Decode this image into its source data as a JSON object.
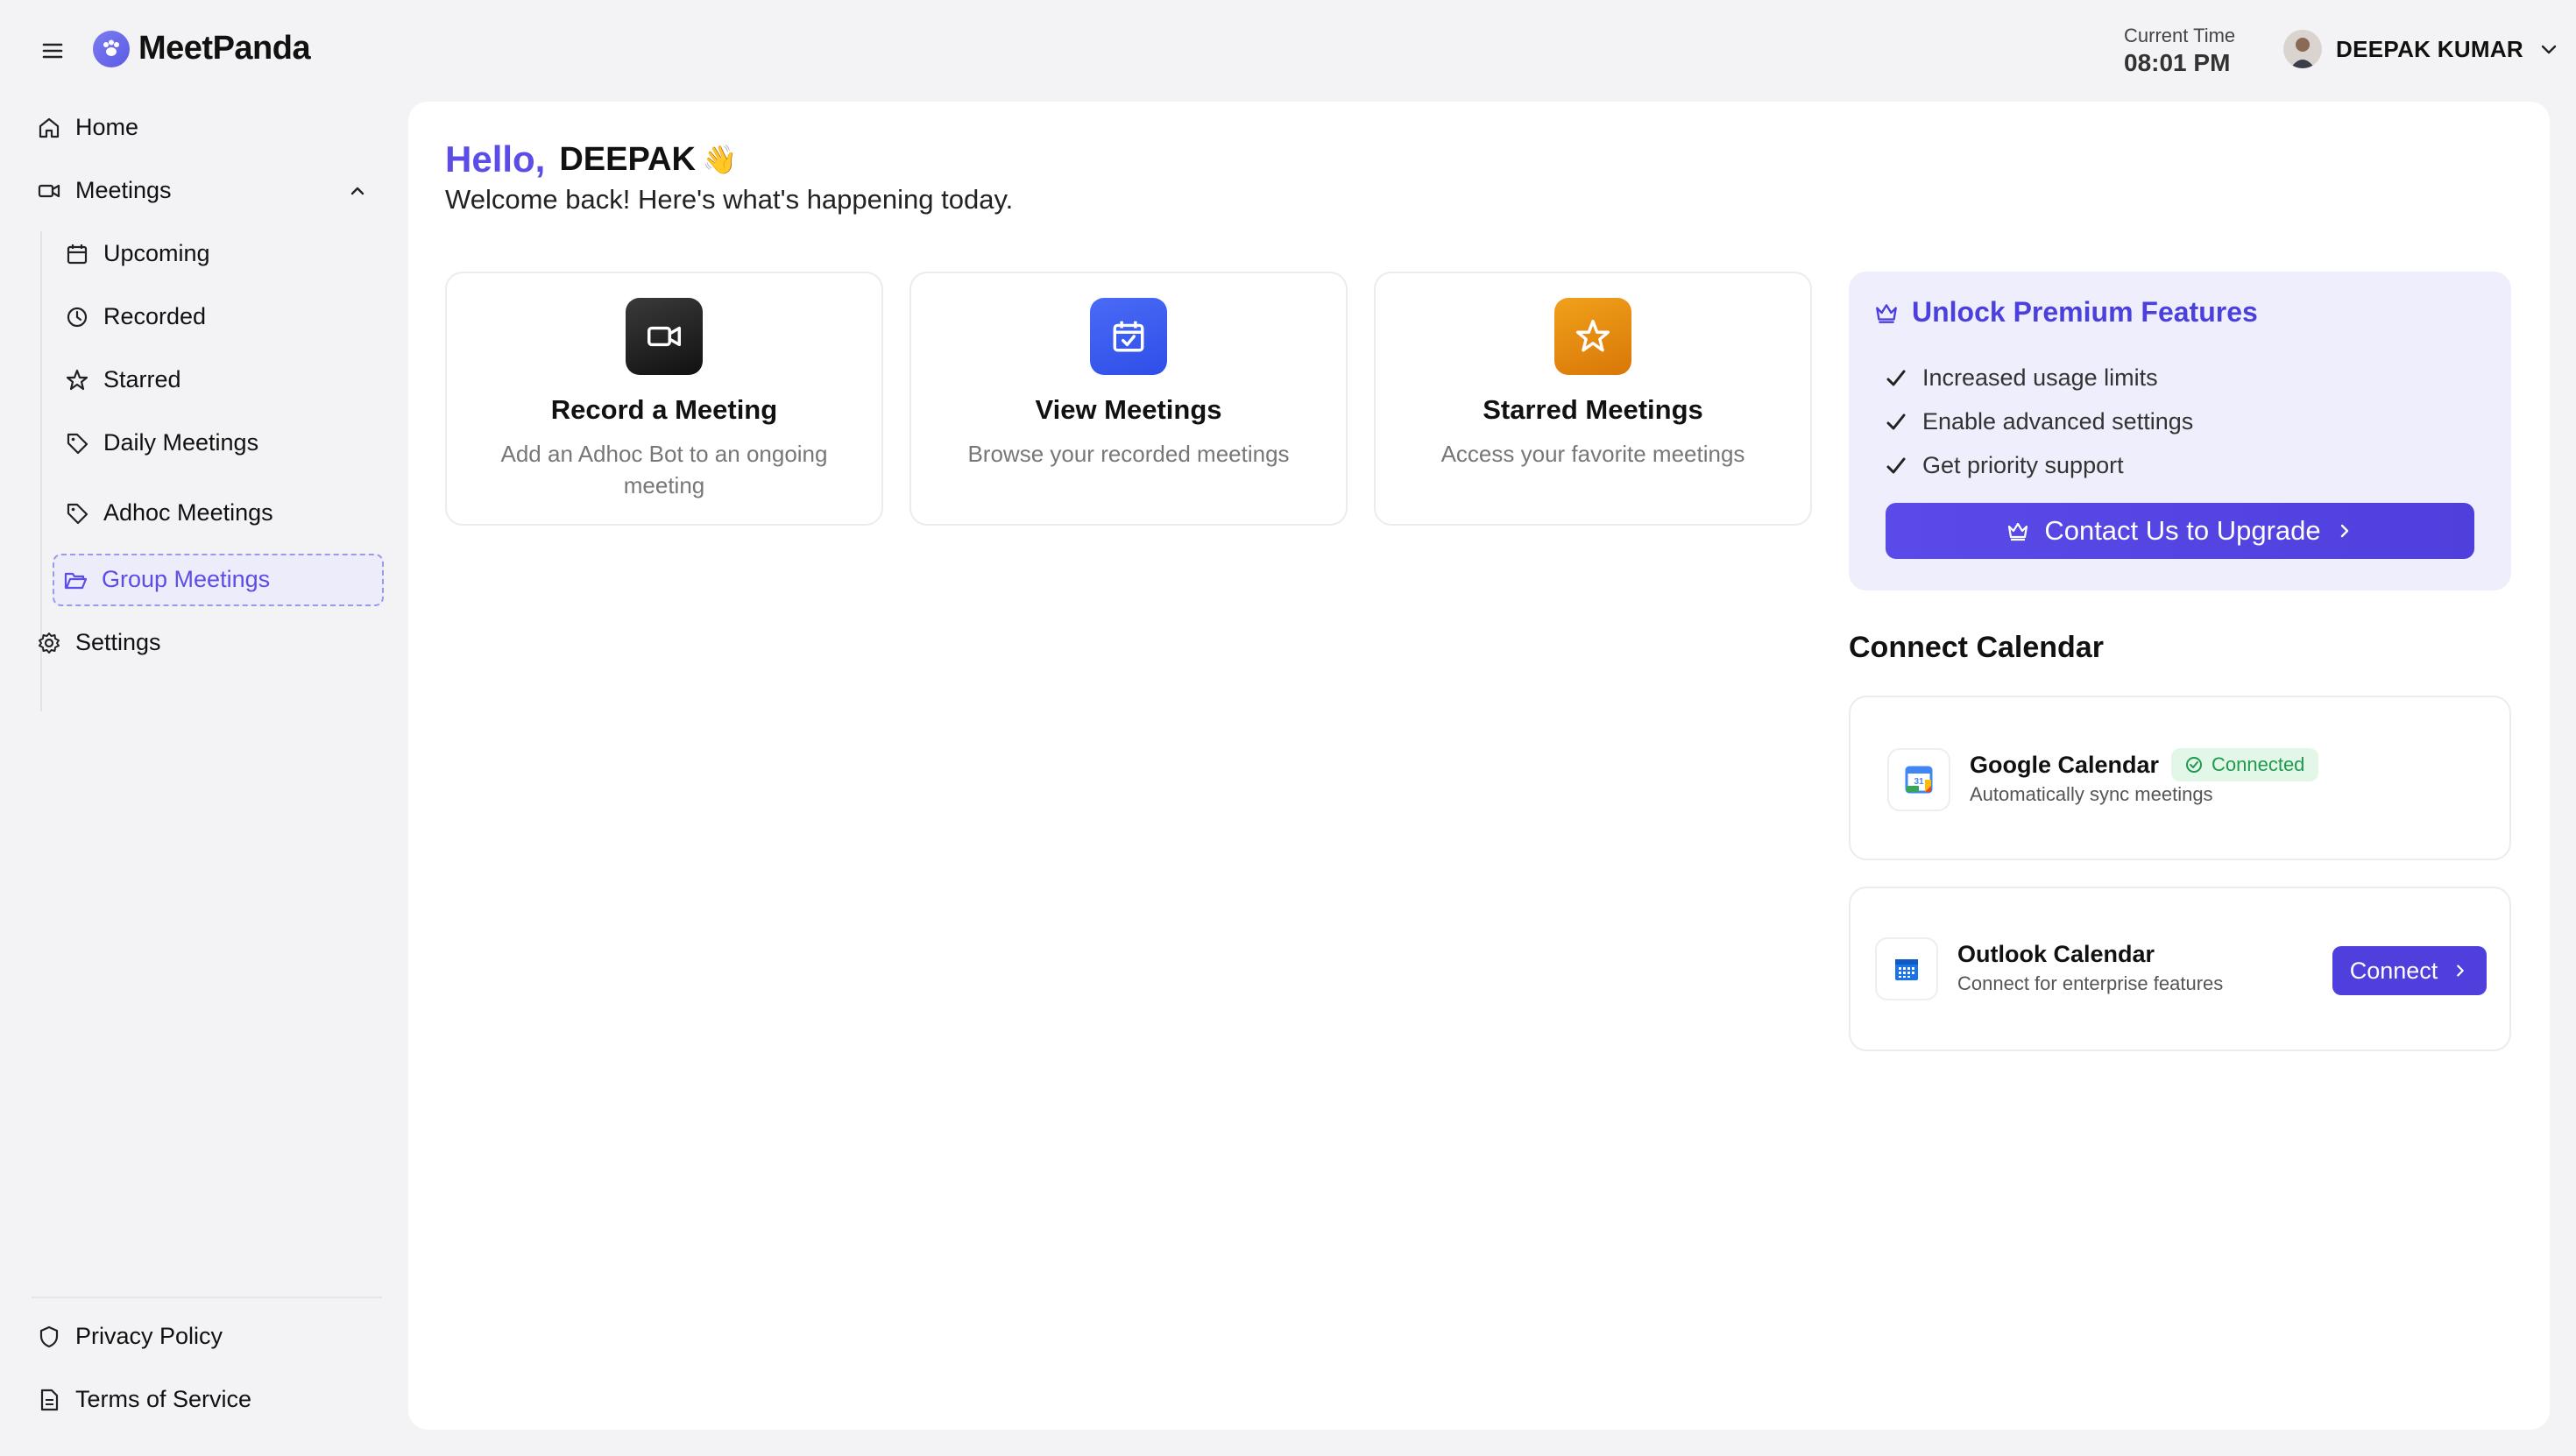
{
  "header": {
    "app_name": "MeetPanda",
    "time_label": "Current Time",
    "time_value": "08:01 PM",
    "user_name": "DEEPAK KUMAR"
  },
  "sidebar": {
    "home": "Home",
    "meetings": "Meetings",
    "upcoming": "Upcoming",
    "recorded": "Recorded",
    "starred": "Starred",
    "daily": "Daily Meetings",
    "adhoc": "Adhoc Meetings",
    "group": "Group Meetings",
    "settings": "Settings",
    "privacy": "Privacy Policy",
    "terms": "Terms of Service"
  },
  "greeting": {
    "hello": "Hello,",
    "name": "DEEPAK",
    "emoji": "👋",
    "welcome": "Welcome back! Here's what's happening today."
  },
  "cards": [
    {
      "title": "Record a Meeting",
      "desc": "Add an Adhoc Bot to an ongoing meeting"
    },
    {
      "title": "View Meetings",
      "desc": "Browse your recorded meetings"
    },
    {
      "title": "Starred Meetings",
      "desc": "Access your favorite meetings"
    }
  ],
  "premium": {
    "title": "Unlock Premium Features",
    "features": [
      "Increased usage limits",
      "Enable advanced settings",
      "Get priority support"
    ],
    "button": "Contact Us to Upgrade"
  },
  "calendar": {
    "heading": "Connect Calendar",
    "google": {
      "title": "Google Calendar",
      "status": "Connected",
      "subtitle": "Automatically sync meetings",
      "icon_day": "31"
    },
    "outlook": {
      "title": "Outlook Calendar",
      "subtitle": "Connect for enterprise features",
      "button": "Connect"
    }
  },
  "colors": {
    "accent": "#5b4de6",
    "badge_green": "#1f9a4c",
    "star_orange": "#e38a0f",
    "view_blue": "#3a5cf0"
  }
}
